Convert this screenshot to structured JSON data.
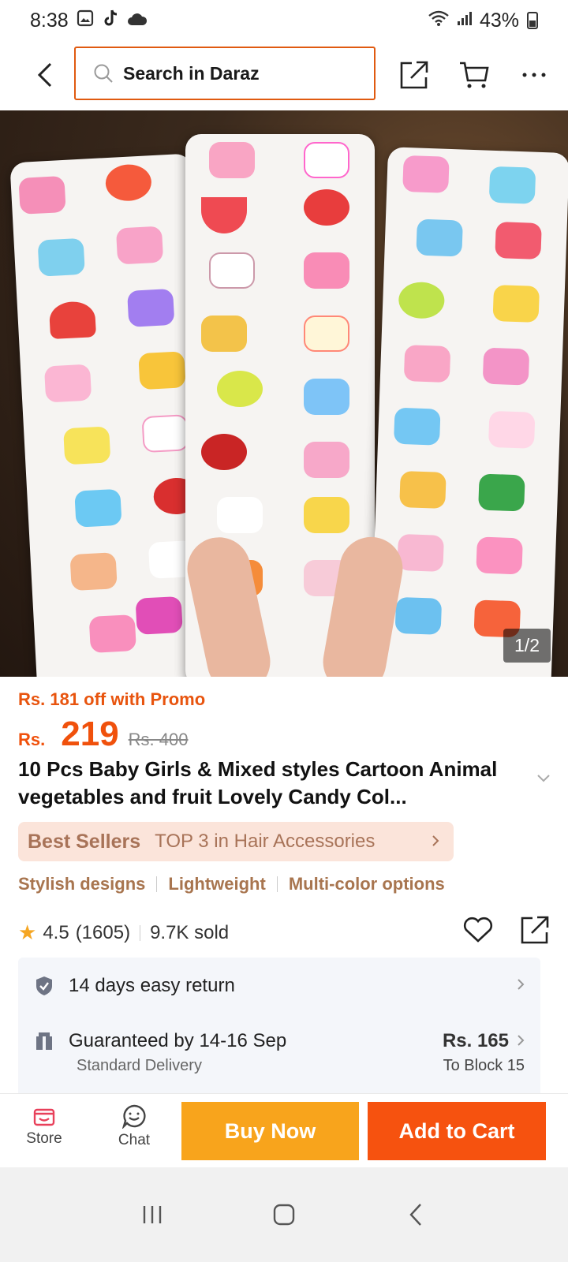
{
  "status_bar": {
    "time": "8:38",
    "battery": "43%"
  },
  "search": {
    "placeholder": "Search in Daraz"
  },
  "image": {
    "counter": "1/2"
  },
  "price": {
    "promo": "Rs. 181 off with Promo",
    "currency": "Rs.",
    "current": "219",
    "original": "Rs. 400"
  },
  "product": {
    "title": "10 Pcs Baby Girls & Mixed styles Cartoon Animal vegetables and fruit Lovely Candy Col..."
  },
  "best_seller": {
    "brand": "Best Sellers",
    "text": "TOP 3 in Hair Accessories"
  },
  "features": [
    "Stylish designs",
    "Lightweight",
    "Multi-color options"
  ],
  "rating": {
    "score": "4.5",
    "count": "(1605)",
    "sold": "9.7K sold"
  },
  "services": {
    "return": "14 days easy return",
    "delivery_title": "Guaranteed by 14-16 Sep",
    "delivery_price": "Rs. 165",
    "delivery_type": "Standard Delivery",
    "delivery_dest": "To Block 15"
  },
  "bottom_bar": {
    "store": "Store",
    "chat": "Chat",
    "buy_now": "Buy Now",
    "add_to_cart": "Add to Cart"
  },
  "colors": {
    "accent": "#f6520f",
    "buy_now": "#f8a41c",
    "promo": "#e8540e",
    "search_border": "#e05a10"
  }
}
